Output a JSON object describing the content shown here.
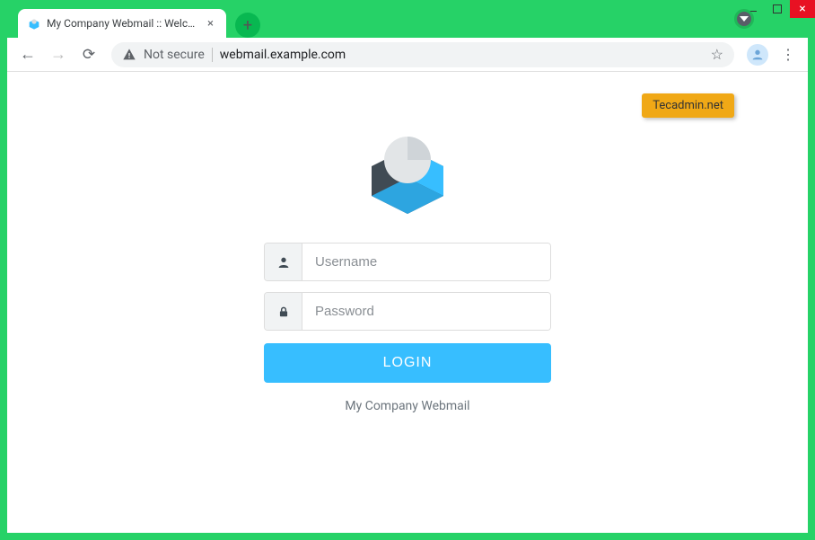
{
  "browser": {
    "tab_title": "My Company Webmail :: Welcom",
    "not_secure_label": "Not secure",
    "url": "webmail.example.com",
    "badge": "Tecadmin.net"
  },
  "login": {
    "username_placeholder": "Username",
    "password_placeholder": "Password",
    "button_label": "LOGIN",
    "caption": "My Company Webmail"
  }
}
